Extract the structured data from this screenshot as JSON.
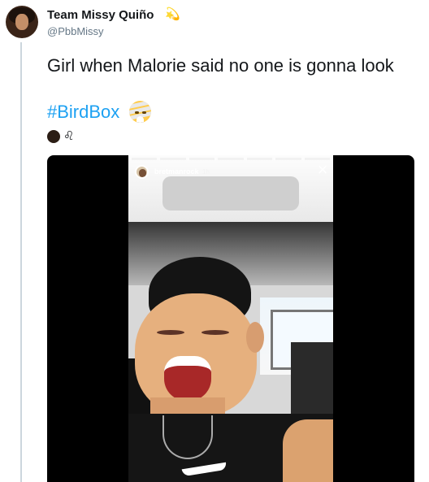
{
  "tweet": {
    "display_name": "Team Missy Quiño",
    "name_emoji": "💫",
    "handle": "@PbbMissy",
    "text": "Girl when Malorie said no one is gonna look",
    "hashtag": "#BirdBox",
    "hashtag_emoji_icon": "mummy-emoji",
    "meta_icon": "leo-zodiac-icon",
    "leo_symbol": "♌"
  },
  "video": {
    "story_username": "bretmanrock",
    "story_time": "1h",
    "close_icon": "close-icon",
    "close_symbol": "×"
  },
  "colors": {
    "text": "#14171a",
    "secondary_text": "#657786",
    "link": "#1da1f2",
    "thread_line": "#ccd6dd"
  }
}
